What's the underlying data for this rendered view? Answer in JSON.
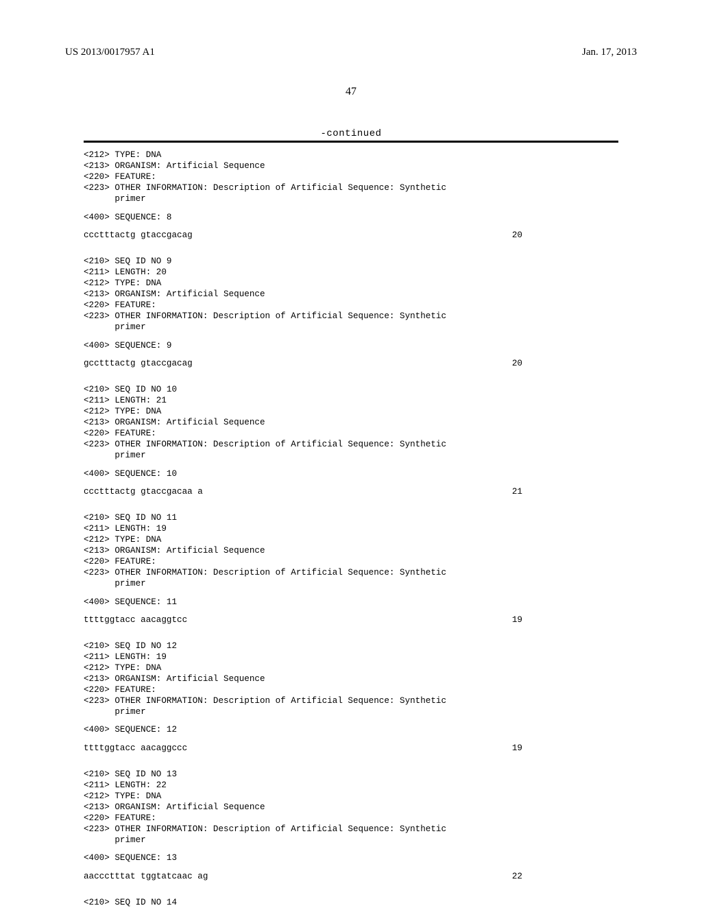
{
  "header": {
    "left": "US 2013/0017957 A1",
    "right": "Jan. 17, 2013"
  },
  "page_number": "47",
  "continued_label": "-continued",
  "entries": [
    {
      "pre_lines": [
        "<212> TYPE: DNA",
        "<213> ORGANISM: Artificial Sequence",
        "<220> FEATURE:",
        "<223> OTHER INFORMATION: Description of Artificial Sequence: Synthetic",
        "      primer"
      ],
      "seq_label": "<400> SEQUENCE: 8",
      "sequence": "ccctttactg gtaccgacag",
      "length_num": "20"
    },
    {
      "pre_lines": [
        "<210> SEQ ID NO 9",
        "<211> LENGTH: 20",
        "<212> TYPE: DNA",
        "<213> ORGANISM: Artificial Sequence",
        "<220> FEATURE:",
        "<223> OTHER INFORMATION: Description of Artificial Sequence: Synthetic",
        "      primer"
      ],
      "seq_label": "<400> SEQUENCE: 9",
      "sequence": "gcctttactg gtaccgacag",
      "length_num": "20"
    },
    {
      "pre_lines": [
        "<210> SEQ ID NO 10",
        "<211> LENGTH: 21",
        "<212> TYPE: DNA",
        "<213> ORGANISM: Artificial Sequence",
        "<220> FEATURE:",
        "<223> OTHER INFORMATION: Description of Artificial Sequence: Synthetic",
        "      primer"
      ],
      "seq_label": "<400> SEQUENCE: 10",
      "sequence": "ccctttactg gtaccgacaa a",
      "length_num": "21"
    },
    {
      "pre_lines": [
        "<210> SEQ ID NO 11",
        "<211> LENGTH: 19",
        "<212> TYPE: DNA",
        "<213> ORGANISM: Artificial Sequence",
        "<220> FEATURE:",
        "<223> OTHER INFORMATION: Description of Artificial Sequence: Synthetic",
        "      primer"
      ],
      "seq_label": "<400> SEQUENCE: 11",
      "sequence": "ttttggtacc aacaggtcc",
      "length_num": "19"
    },
    {
      "pre_lines": [
        "<210> SEQ ID NO 12",
        "<211> LENGTH: 19",
        "<212> TYPE: DNA",
        "<213> ORGANISM: Artificial Sequence",
        "<220> FEATURE:",
        "<223> OTHER INFORMATION: Description of Artificial Sequence: Synthetic",
        "      primer"
      ],
      "seq_label": "<400> SEQUENCE: 12",
      "sequence": "ttttggtacc aacaggccc",
      "length_num": "19"
    },
    {
      "pre_lines": [
        "<210> SEQ ID NO 13",
        "<211> LENGTH: 22",
        "<212> TYPE: DNA",
        "<213> ORGANISM: Artificial Sequence",
        "<220> FEATURE:",
        "<223> OTHER INFORMATION: Description of Artificial Sequence: Synthetic",
        "      primer"
      ],
      "seq_label": "<400> SEQUENCE: 13",
      "sequence": "aaccctttat tggtatcaac ag",
      "length_num": "22"
    }
  ],
  "trailing_line": "<210> SEQ ID NO 14"
}
